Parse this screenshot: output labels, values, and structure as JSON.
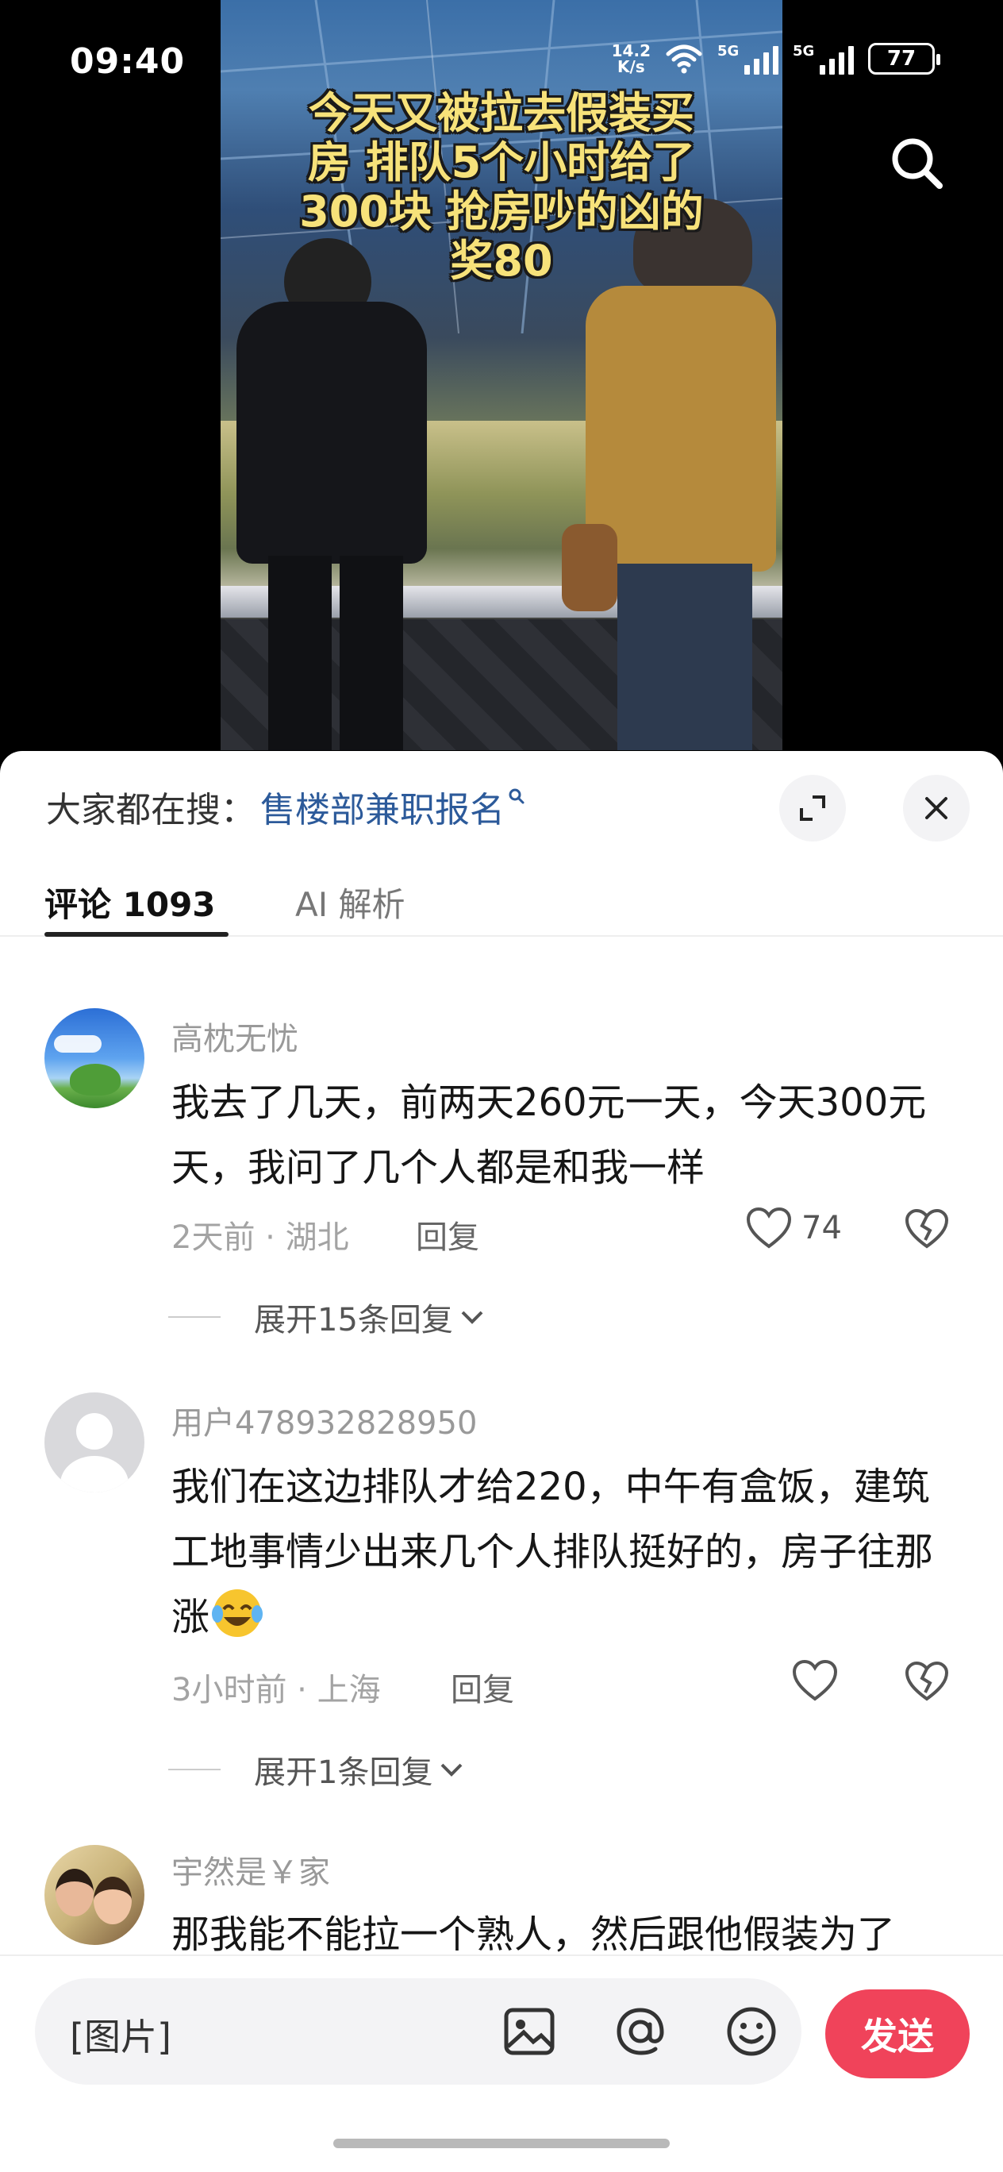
{
  "status": {
    "time": "09:40",
    "net_speed_value": "14.2",
    "net_speed_unit": "K/s",
    "sim1": "5G",
    "sim2": "5G",
    "battery": "77"
  },
  "video": {
    "caption_lines": [
      "今天又被拉去假装买",
      "房 排队5个小时给了",
      "300块 抢房吵的凶的",
      "奖80"
    ]
  },
  "sheet": {
    "hot_search_label": "大家都在搜：",
    "hot_search_term": "售楼部兼职报名",
    "tabs": [
      {
        "label": "评论 1093"
      },
      {
        "label": "AI 解析"
      }
    ]
  },
  "comments": [
    {
      "user": "高枕无忧",
      "text": "我去了几天，前两天260元一天，今天300元天，我问了几个人都是和我一样",
      "meta": "2天前 · 湖北",
      "reply_label": "回复",
      "likes": "74",
      "expand": "展开15条回复"
    },
    {
      "user": "用户478932828950",
      "text": "我们在这边排队才给220，中午有盒饭，建筑工地事情少出来几个人排队挺好的，房子往那涨",
      "meta": "3小时前 · 上海",
      "reply_label": "回复",
      "likes": "",
      "expand": "展开1条回复"
    },
    {
      "user": "宇然是￥家",
      "text": "那我能不能拉一个熟人，然后跟他假装为了"
    }
  ],
  "input": {
    "placeholder": "[图片]",
    "send_label": "发送"
  },
  "colors": {
    "accent": "#f0435a",
    "link": "#2c5a9a",
    "caption": "#f7e27a"
  }
}
